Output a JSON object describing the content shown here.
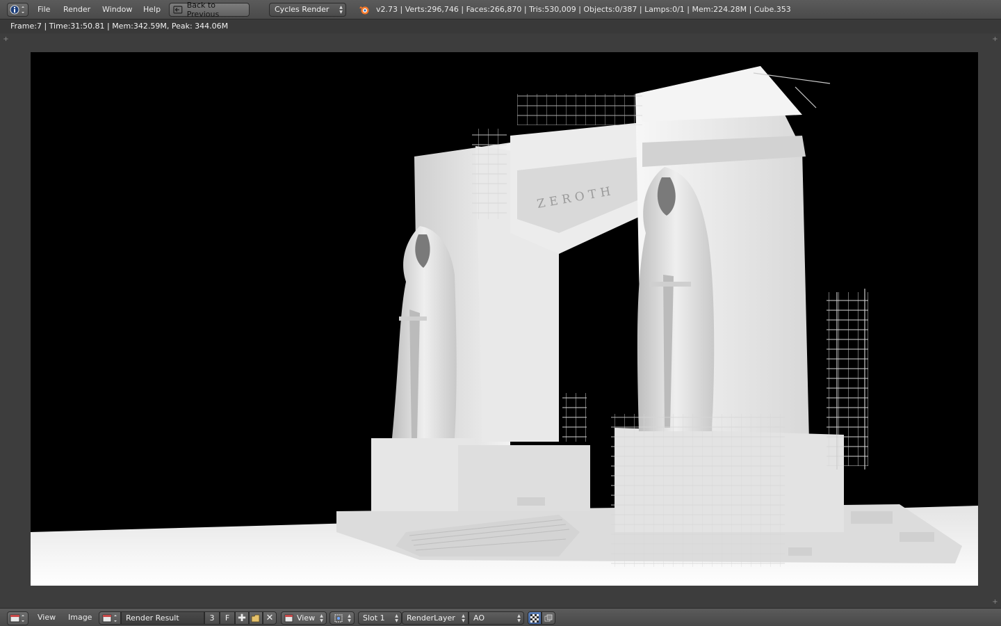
{
  "header": {
    "editor_type_icon": "info-icon",
    "menus": [
      "File",
      "Render",
      "Window",
      "Help"
    ],
    "back_button_label": "Back to Previous",
    "render_engine": "Cycles Render",
    "scene_stats": "v2.73 | Verts:296,746 | Faces:266,870 | Tris:530,009 | Objects:0/387 | Lamps:0/1 | Mem:224.28M | Cube.353"
  },
  "render_info": "Frame:7 | Time:31:50.81 | Mem:342.59M, Peak: 344.06M",
  "render_image": {
    "description_icon": "render-result-image",
    "inscription": "ZEROTH"
  },
  "footer": {
    "editor_type_icon": "image-editor-icon",
    "menus": [
      "View",
      "Image"
    ],
    "image_browse_icon": "image-browse-icon",
    "image_name": "Render Result",
    "user_count": "3",
    "fake_user": "F",
    "view_label": "View",
    "slot": "Slot 1",
    "render_layer": "RenderLayer",
    "pass": "AO"
  },
  "colors": {
    "header_bg": "#4f4f4f",
    "viewport_bg": "#3d3d3d",
    "render_bg": "#000000",
    "model_white": "#e8e8e8"
  }
}
